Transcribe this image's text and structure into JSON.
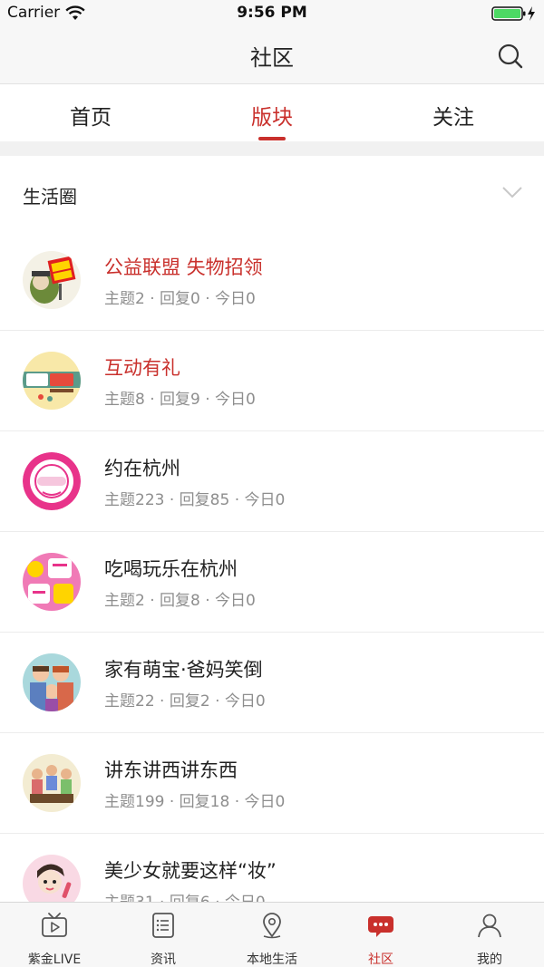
{
  "status_bar": {
    "carrier": "Carrier",
    "time": "9:56 PM"
  },
  "header": {
    "title": "社区"
  },
  "tabs": [
    {
      "label": "首页",
      "active": false
    },
    {
      "label": "版块",
      "active": true
    },
    {
      "label": "关注",
      "active": false
    }
  ],
  "section": {
    "title": "生活圈"
  },
  "forums": [
    {
      "title": "公益联盟 失物招领",
      "meta": "主题2 · 回复0 · 今日0",
      "highlight": true,
      "icon": "lost-and-found-avatar"
    },
    {
      "title": "互动有礼",
      "meta": "主题8 · 回复9 · 今日0",
      "highlight": true,
      "icon": "gift-avatar"
    },
    {
      "title": "约在杭州",
      "meta": "主题223 · 回复85 · 今日0",
      "highlight": false,
      "icon": "meet-hangzhou-avatar"
    },
    {
      "title": "吃喝玩乐在杭州",
      "meta": "主题2 · 回复8 · 今日0",
      "highlight": false,
      "icon": "food-fun-avatar"
    },
    {
      "title": "家有萌宝·爸妈笑倒",
      "meta": "主题22 · 回复2 · 今日0",
      "highlight": false,
      "icon": "family-avatar"
    },
    {
      "title": "讲东讲西讲东西",
      "meta": "主题199 · 回复18 · 今日0",
      "highlight": false,
      "icon": "chat-group-avatar"
    },
    {
      "title": "美少女就要这样“妆”",
      "meta": "主题31 · 回复6 · 今日0",
      "highlight": false,
      "icon": "makeup-avatar"
    }
  ],
  "tab_bar": [
    {
      "label": "紫金LIVE",
      "icon": "tv-icon",
      "active": false
    },
    {
      "label": "资讯",
      "icon": "news-icon",
      "active": false
    },
    {
      "label": "本地生活",
      "icon": "location-pin-icon",
      "active": false
    },
    {
      "label": "社区",
      "icon": "chat-bubble-icon",
      "active": true
    },
    {
      "label": "我的",
      "icon": "person-icon",
      "active": false
    }
  ],
  "colors": {
    "accent": "#c9302c",
    "meta_text": "#8e8e8e",
    "bar_background": "#f7f7f7"
  }
}
